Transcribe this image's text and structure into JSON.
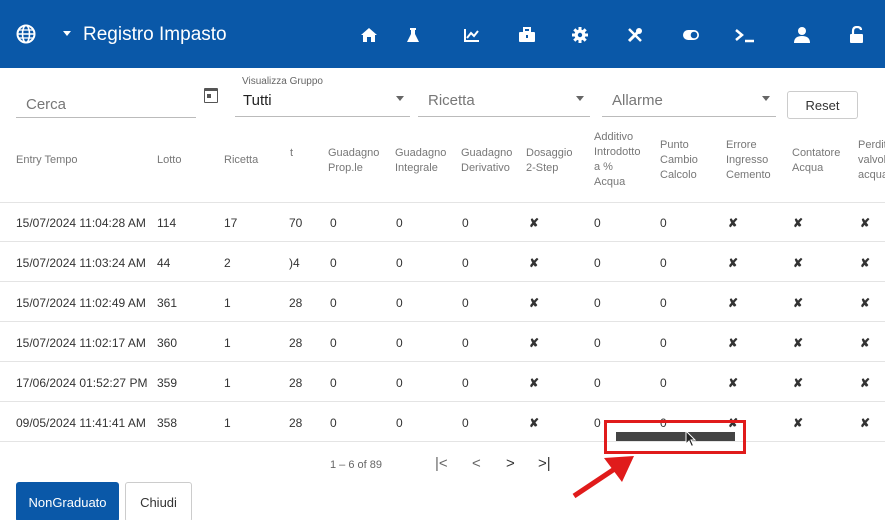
{
  "header": {
    "title": "Registro Impasto",
    "icons": [
      "globe-icon",
      "home-icon",
      "flask-icon",
      "chart-line-icon",
      "toolbox-icon",
      "gear-icon",
      "tools-icon",
      "toggle-icon",
      "terminal-icon",
      "user-icon",
      "unlock-icon"
    ],
    "color": "#0a58a8"
  },
  "filters": {
    "search_placeholder": "Cerca",
    "group_label": "Visualizza Gruppo",
    "group_value": "Tutti",
    "recipe_placeholder": "Ricetta",
    "alarm_placeholder": "Allarme",
    "reset_label": "Reset"
  },
  "table": {
    "columns": [
      "Entry Tempo",
      "Lotto",
      "Ricetta",
      "t",
      "Guadagno Prop.le",
      "Guadagno Integrale",
      "Guadagno Derivativo",
      "Dosaggio 2-Step",
      "Additivo Introdotto a % Acqua",
      "Punto Cambio Calcolo",
      "Errore Ingresso Cemento",
      "Contatore Acqua",
      "Perdita valvola acqua"
    ],
    "rows": [
      {
        "time": "15/07/2024 11:04:28 AM",
        "lotto": "114",
        "ricetta": "17",
        "t": "70",
        "gp": "0",
        "gi": "0",
        "gd": "0",
        "dos": "✘",
        "add": "0",
        "pcc": "0",
        "eic": "✘",
        "ca": "✘",
        "pva": "✘"
      },
      {
        "time": "15/07/2024 11:03:24 AM",
        "lotto": "44",
        "ricetta": "2",
        "t": ")4",
        "gp": "0",
        "gi": "0",
        "gd": "0",
        "dos": "✘",
        "add": "0",
        "pcc": "0",
        "eic": "✘",
        "ca": "✘",
        "pva": "✘"
      },
      {
        "time": "15/07/2024 11:02:49 AM",
        "lotto": "361",
        "ricetta": "1",
        "t": "28",
        "gp": "0",
        "gi": "0",
        "gd": "0",
        "dos": "✘",
        "add": "0",
        "pcc": "0",
        "eic": "✘",
        "ca": "✘",
        "pva": "✘"
      },
      {
        "time": "15/07/2024 11:02:17 AM",
        "lotto": "360",
        "ricetta": "1",
        "t": "28",
        "gp": "0",
        "gi": "0",
        "gd": "0",
        "dos": "✘",
        "add": "0",
        "pcc": "0",
        "eic": "✘",
        "ca": "✘",
        "pva": "✘"
      },
      {
        "time": "17/06/2024 01:52:27 PM",
        "lotto": "359",
        "ricetta": "1",
        "t": "28",
        "gp": "0",
        "gi": "0",
        "gd": "0",
        "dos": "✘",
        "add": "0",
        "pcc": "0",
        "eic": "✘",
        "ca": "✘",
        "pva": "✘"
      },
      {
        "time": "09/05/2024 11:41:41 AM",
        "lotto": "358",
        "ricetta": "1",
        "t": "28",
        "gp": "0",
        "gi": "0",
        "gd": "0",
        "dos": "✘",
        "add": "0",
        "pcc": "0",
        "eic": "✘",
        "ca": "✘",
        "pva": "✘"
      }
    ]
  },
  "paginator": {
    "range_label": "1 – 6 of 89",
    "first": "|<",
    "prev": "<",
    "next": ">",
    "last": ">|"
  },
  "actions": {
    "nongraduato_label": "NonGraduato",
    "chiudi_label": "Chiudi"
  },
  "highlight_color": "#e01b1b"
}
